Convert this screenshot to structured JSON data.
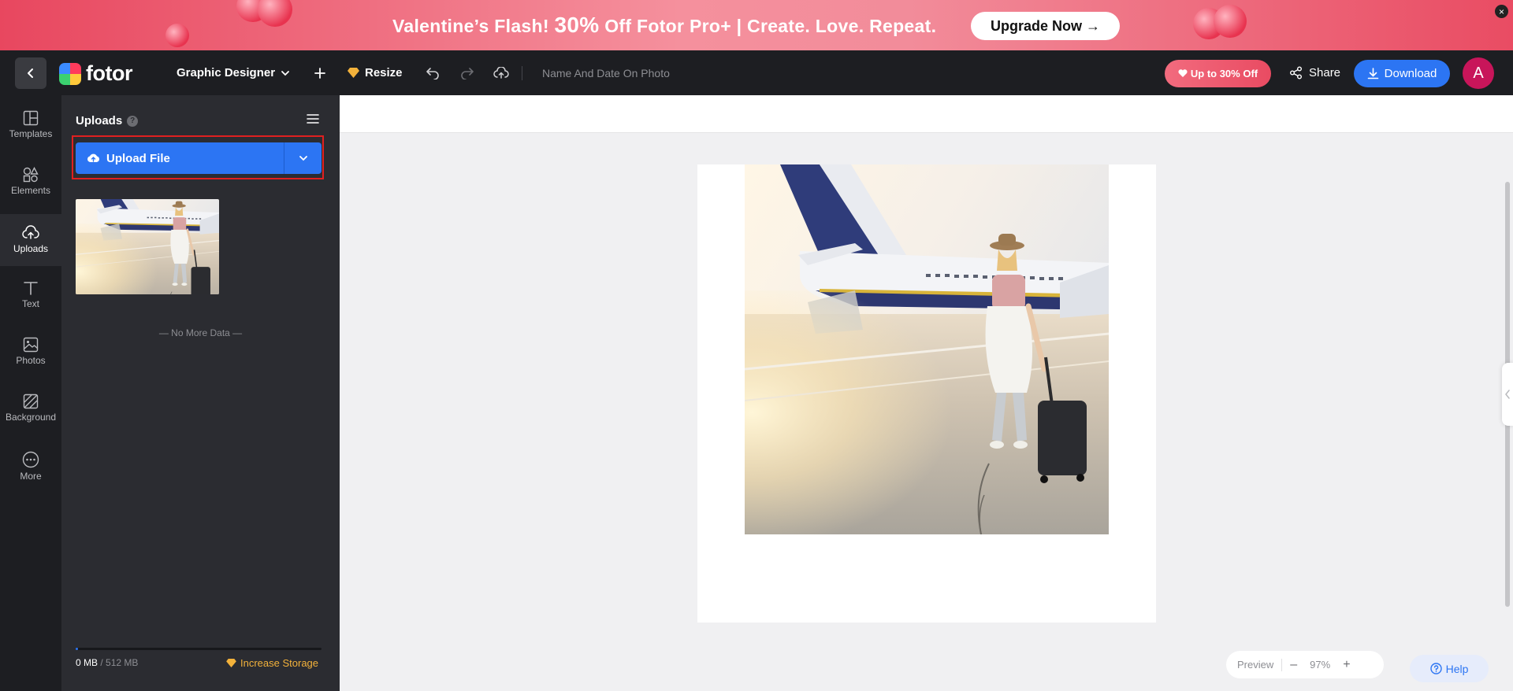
{
  "banner": {
    "text_prefix": "Valentine’s Flash!",
    "percent": "30%",
    "text_suffix": "Off Fotor Pro+ | Create. Love. Repeat.",
    "cta": "Upgrade Now →",
    "close": "×"
  },
  "topbar": {
    "logo": "fotor",
    "mode": "Graphic Designer",
    "resize": "Resize",
    "doc_name": "Name And Date On Photo",
    "promo": "Up to 30% Off",
    "share": "Share",
    "download": "Download",
    "avatar": "A"
  },
  "leftnav": {
    "items": [
      {
        "label": "Templates",
        "icon": "templates-icon"
      },
      {
        "label": "Elements",
        "icon": "elements-icon"
      },
      {
        "label": "Uploads",
        "icon": "uploads-icon"
      },
      {
        "label": "Text",
        "icon": "text-icon"
      },
      {
        "label": "Photos",
        "icon": "photos-icon"
      },
      {
        "label": "Background",
        "icon": "background-icon"
      },
      {
        "label": "More",
        "icon": "more-icon"
      }
    ],
    "active": "Uploads"
  },
  "panel": {
    "title": "Uploads",
    "help": "?",
    "upload_button": "Upload File",
    "no_more": "— No More Data —",
    "storage_used": "0 MB",
    "storage_total": " / 512 MB",
    "storage_fraction": 0.0,
    "increase": "Increase Storage"
  },
  "zoom": {
    "preview": "Preview",
    "minus": "–",
    "level": "97%",
    "plus": "+"
  },
  "help": "Help",
  "colors": {
    "accent": "#2c75f3",
    "banner": "#e8475f",
    "highlight_frame": "#e02020",
    "storage": "#f3b23b"
  }
}
